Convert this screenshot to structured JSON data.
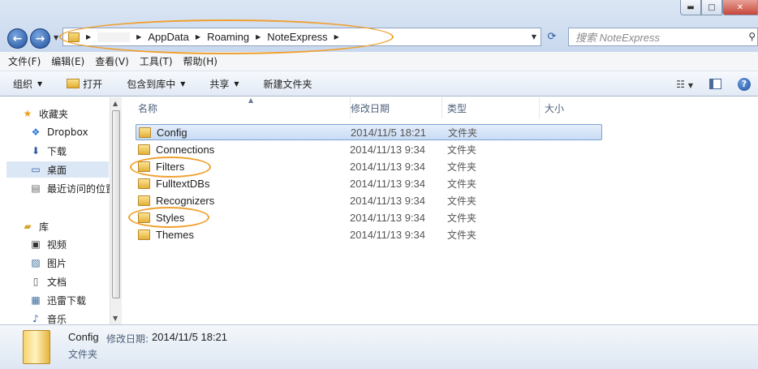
{
  "window": {
    "minimize": "▬",
    "maximize": "□",
    "close": "✕"
  },
  "nav": {
    "back_icon": "back-arrow-icon",
    "forward_icon": "forward-arrow-icon"
  },
  "address": {
    "crumbs": [
      "AppData",
      "Roaming",
      "NoteExpress"
    ],
    "search_placeholder": "搜索 NoteExpress"
  },
  "menu": [
    "文件(F)",
    "编辑(E)",
    "查看(V)",
    "工具(T)",
    "帮助(H)"
  ],
  "commands": {
    "organize": "组织",
    "open": "打开",
    "include_library": "包含到库中",
    "share": "共享",
    "new_folder": "新建文件夹"
  },
  "sidebar": {
    "favorites": [
      {
        "label": "收藏夹",
        "icon": "star-icon"
      },
      {
        "label": "Dropbox",
        "icon": "dropbox-icon"
      },
      {
        "label": "下载",
        "icon": "download-folder-icon"
      },
      {
        "label": "桌面",
        "icon": "desktop-icon"
      },
      {
        "label": "最近访问的位置",
        "icon": "recent-places-icon"
      }
    ],
    "libraries": [
      {
        "label": "库",
        "icon": "library-icon"
      },
      {
        "label": "视频",
        "icon": "video-icon"
      },
      {
        "label": "图片",
        "icon": "picture-icon"
      },
      {
        "label": "文档",
        "icon": "document-icon"
      },
      {
        "label": "迅雷下载",
        "icon": "folder-icon"
      },
      {
        "label": "音乐",
        "icon": "music-icon"
      }
    ]
  },
  "columns": {
    "name": "名称",
    "modified": "修改日期",
    "type": "类型",
    "size": "大小"
  },
  "files": [
    {
      "name": "Config",
      "modified": "2014/11/5 18:21",
      "type": "文件夹"
    },
    {
      "name": "Connections",
      "modified": "2014/11/13 9:34",
      "type": "文件夹"
    },
    {
      "name": "Filters",
      "modified": "2014/11/13 9:34",
      "type": "文件夹"
    },
    {
      "name": "FulltextDBs",
      "modified": "2014/11/13 9:34",
      "type": "文件夹"
    },
    {
      "name": "Recognizers",
      "modified": "2014/11/13 9:34",
      "type": "文件夹"
    },
    {
      "name": "Styles",
      "modified": "2014/11/13 9:34",
      "type": "文件夹"
    },
    {
      "name": "Themes",
      "modified": "2014/11/13 9:34",
      "type": "文件夹"
    }
  ],
  "details": {
    "name": "Config",
    "modified_label": "修改日期:",
    "modified": "2014/11/5 18:21",
    "type": "文件夹"
  },
  "colors": {
    "callout": "#f0a030",
    "selection": "#c9dcf5"
  }
}
